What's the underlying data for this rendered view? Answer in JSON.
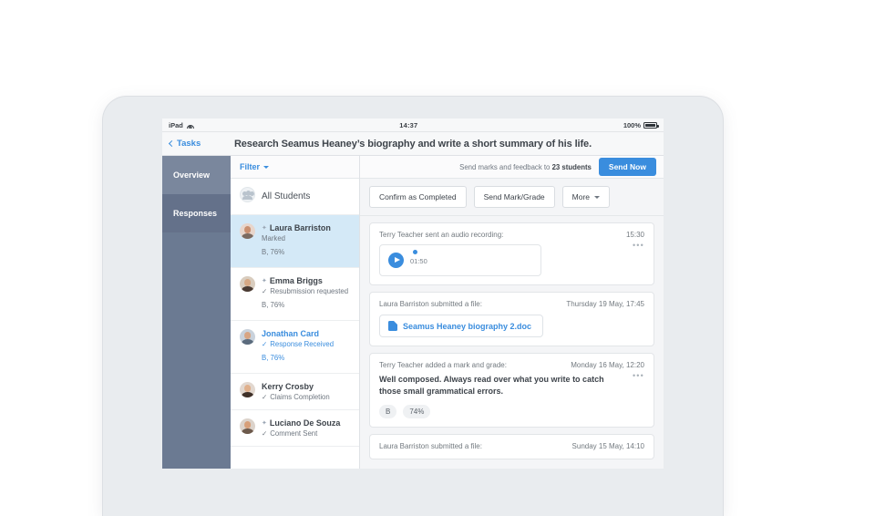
{
  "status_bar": {
    "device": "iPad",
    "wifi_icon": "wifi-icon",
    "time": "14:37",
    "battery_percent": "100%",
    "battery_icon": "battery-full-icon"
  },
  "nav": {
    "back_label": "Tasks",
    "back_icon": "chevron-left-icon",
    "title": "Research Seamus Heaney’s biography and write a short summary of his life."
  },
  "sidebar": {
    "items": [
      {
        "label": "Overview",
        "active": false
      },
      {
        "label": "Responses",
        "active": true
      }
    ]
  },
  "filter": {
    "label": "Filter",
    "caret_icon": "chevron-down-icon"
  },
  "students": [
    {
      "name": "All Students",
      "icon": "group-avatar-icon",
      "is_group": true
    },
    {
      "name": "Laura Barriston",
      "status": "Marked",
      "grade": "B, 76%",
      "starred": true,
      "tick": false,
      "selected": true,
      "link": false
    },
    {
      "name": "Emma Briggs",
      "status": "Resubmission requested",
      "grade": "B, 76%",
      "starred": true,
      "tick": true,
      "selected": false,
      "link": false
    },
    {
      "name": "Jonathan Card",
      "status": "Response Received",
      "grade": "B, 76%",
      "starred": false,
      "tick": true,
      "selected": false,
      "link": true
    },
    {
      "name": "Kerry Crosby",
      "status": "Claims Completion",
      "grade": "",
      "starred": false,
      "tick": true,
      "selected": false,
      "link": false
    },
    {
      "name": "Luciano De Souza",
      "status": "Comment Sent",
      "grade": "",
      "starred": true,
      "tick": true,
      "selected": false,
      "link": false
    }
  ],
  "send_bar": {
    "prefix": "Send marks and feedback to ",
    "count": "23 students",
    "button_label": "Send Now"
  },
  "actions": [
    {
      "label": "Confirm as Completed",
      "has_caret": false
    },
    {
      "label": "Send Mark/Grade",
      "has_caret": false
    },
    {
      "label": "More",
      "has_caret": true
    }
  ],
  "feed": [
    {
      "type": "audio",
      "actor": "Terry Teacher sent an audio recording:",
      "time": "15:30",
      "duration": "01:50",
      "play_icon": "play-icon",
      "menu_icon": "ellipsis-icon"
    },
    {
      "type": "file",
      "actor": "Laura Barriston submitted a file:",
      "time": "Thursday 19 May, 17:45",
      "file_name": "Seamus Heaney biography 2.doc",
      "file_icon": "document-icon"
    },
    {
      "type": "mark",
      "actor": "Terry Teacher added a mark and grade:",
      "time": "Monday 16 May, 12:20",
      "body": "Well composed. Always read over what you write to catch those small grammatical errors.",
      "grade_badge": "B",
      "percent_badge": "74%",
      "menu_icon": "ellipsis-icon"
    },
    {
      "type": "file",
      "actor": "Laura Barriston submitted a file:",
      "time": "Sunday 15 May, 14:10"
    }
  ]
}
